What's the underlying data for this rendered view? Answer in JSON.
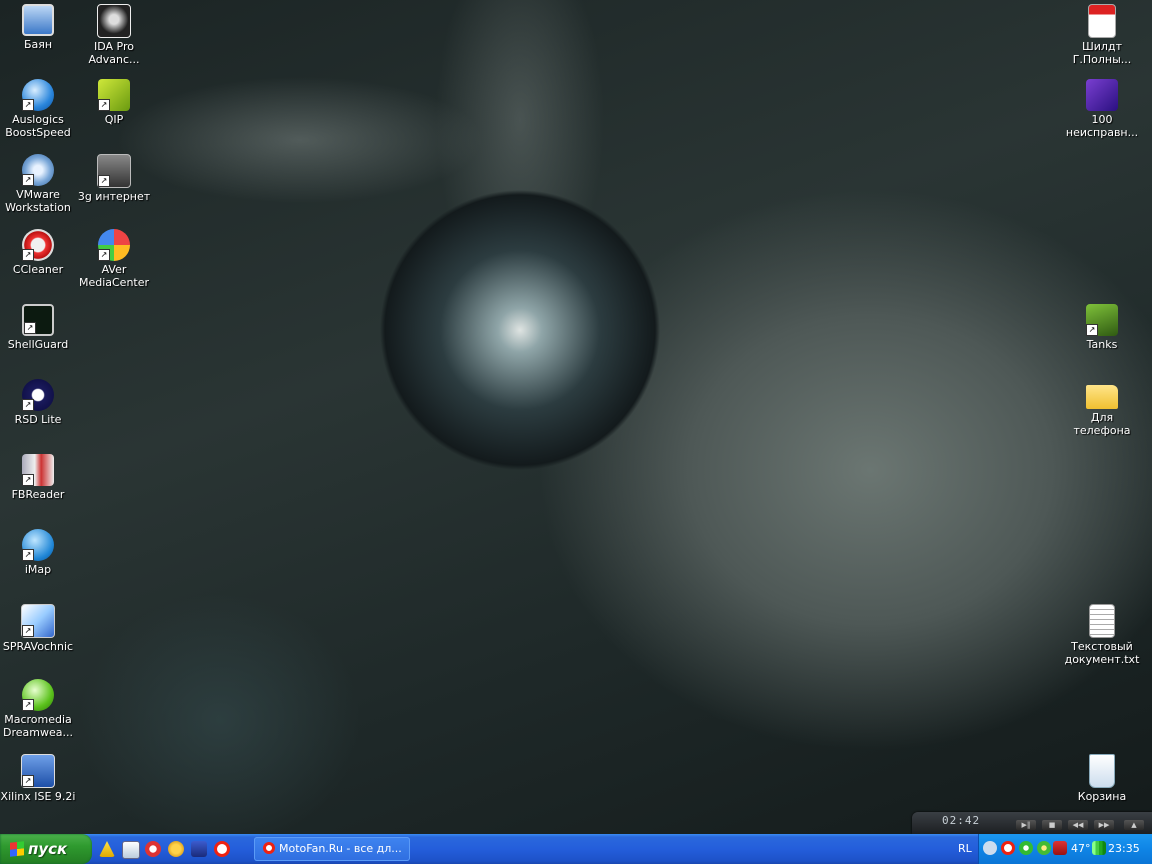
{
  "desktop": {
    "icons_left": [
      {
        "label": "Баян",
        "icon": "monitor-icon"
      },
      {
        "label": "IDA Pro Advanc...",
        "icon": "ida-pro-icon"
      },
      {
        "label": "Auslogics BoostSpeed",
        "icon": "auslogics-icon"
      },
      {
        "label": "QIP",
        "icon": "qip-icon"
      },
      {
        "label": "VMware Workstation",
        "icon": "vmware-icon"
      },
      {
        "label": "3g интернет",
        "icon": "modem-icon"
      },
      {
        "label": "CCleaner",
        "icon": "ccleaner-icon"
      },
      {
        "label": "AVer MediaCenter",
        "icon": "aver-icon"
      },
      {
        "label": "ShellGuard",
        "icon": "shellguard-icon"
      },
      {
        "label": "RSD Lite",
        "icon": "motorola-icon"
      },
      {
        "label": "FBReader",
        "icon": "fbreader-icon"
      },
      {
        "label": "iMap",
        "icon": "imap-icon"
      },
      {
        "label": "SPRAVochnic",
        "icon": "spravochnic-icon"
      },
      {
        "label": "Macromedia Dreamwea...",
        "icon": "dreamweaver-icon"
      },
      {
        "label": "Xilinx  ISE 9.2i",
        "icon": "xilinx-icon"
      }
    ],
    "icons_right": [
      {
        "label": "Шилдт Г.Полны...",
        "icon": "pdf-icon"
      },
      {
        "label": "100 неисправн...",
        "icon": "document-icon"
      },
      {
        "label": "Tanks",
        "icon": "tank-icon"
      },
      {
        "label": "Для телефона",
        "icon": "folder-icon"
      },
      {
        "label": "Текстовый документ.txt",
        "icon": "text-file-icon"
      },
      {
        "label": "Корзина",
        "icon": "recycle-bin-icon"
      }
    ]
  },
  "media_player": {
    "time": "02:42"
  },
  "taskbar": {
    "start_label": "пуск",
    "task_label": "MotoFan.Ru - все дл...",
    "language": "RL",
    "tray_percent": "47°",
    "clock": "23:35"
  },
  "colors": {
    "taskbar": "#245edb",
    "start_button": "#2f9a2f",
    "tray": "#0f85e6"
  }
}
